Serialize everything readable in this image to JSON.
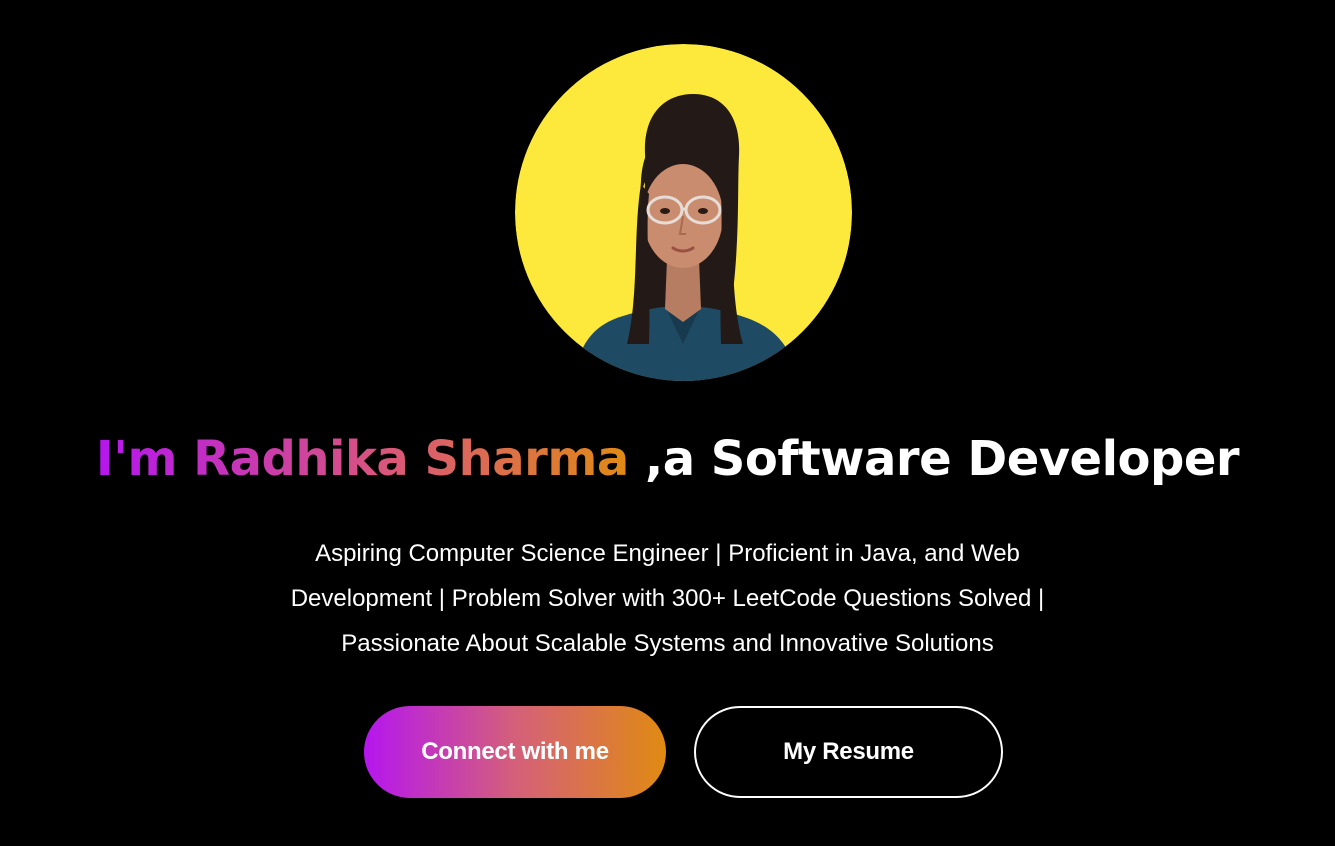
{
  "hero": {
    "headline_name": "I'm Radhika Sharma",
    "headline_role": " ,a Software Developer",
    "tagline_lines": [
      "Aspiring Computer Science Engineer | Proficient in Java, and Web",
      "Development | Problem Solver with 300+ LeetCode Questions Solved |",
      "Passionate About Scalable Systems and Innovative Solutions"
    ],
    "connect_label": "Connect with me",
    "resume_label": "My Resume"
  },
  "colors": {
    "background": "#000000",
    "avatar_bg": "#fde93b",
    "gradient_start": "#b516ef",
    "gradient_mid": "#d9577a",
    "gradient_end": "#e08a14",
    "text": "#ffffff"
  },
  "icons": {
    "avatar": "profile-photo"
  }
}
